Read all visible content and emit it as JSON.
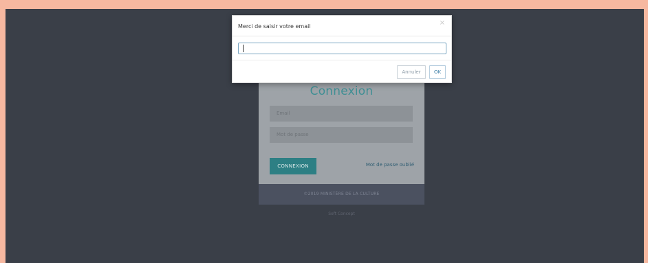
{
  "login": {
    "title": "Connexion",
    "email_placeholder": "Email",
    "password_placeholder": "Mot de passe",
    "submit_label": "CONNEXION",
    "forgot_label": "Mot de passe oublié"
  },
  "footer": {
    "copyright": "©2019 MINISTÈRE DE LA CULTURE",
    "credit": "Soft Concept"
  },
  "modal": {
    "title": "Merci de saisir votre email",
    "close_symbol": "×",
    "input_value": "",
    "cancel_label": "Annuler",
    "ok_label": "OK"
  }
}
